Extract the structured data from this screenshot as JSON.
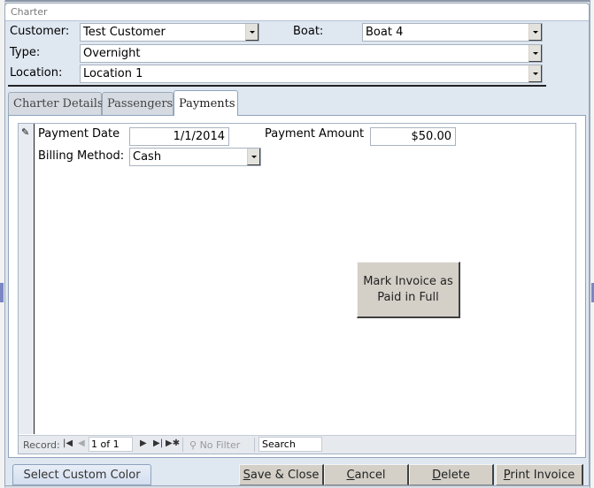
{
  "window": {
    "title": "Charter"
  },
  "header": {
    "customer": {
      "label": "Customer:",
      "value": "Test Customer"
    },
    "boat": {
      "label": "Boat:",
      "value": "Boat 4"
    },
    "type": {
      "label": "Type:",
      "value": "Overnight"
    },
    "location": {
      "label": "Location:",
      "value": "Location 1"
    }
  },
  "tabs": [
    {
      "label": "Charter Details",
      "active": false
    },
    {
      "label": "Passengers",
      "active": false
    },
    {
      "label": "Payments",
      "active": true
    }
  ],
  "payments": {
    "payment_date": {
      "label": "Payment Date",
      "value": "1/1/2014"
    },
    "payment_amount": {
      "label": "Payment Amount",
      "value": "$50.00"
    },
    "billing_method": {
      "label": "Billing Method:",
      "value": "Cash"
    },
    "mark_paid_button": {
      "line1": "Mark Invoice as",
      "line2": "Paid in Full"
    }
  },
  "record_nav": {
    "label": "Record:",
    "current": "1 of 1",
    "filter": "No Filter",
    "search_placeholder": "Search"
  },
  "footer": {
    "custom_color": "Select Custom Color",
    "save_close": {
      "accel": "S",
      "rest": "ave & Close"
    },
    "cancel": {
      "accel": "C",
      "rest": "ancel"
    },
    "delete": {
      "accel": "D",
      "rest": "elete"
    },
    "print_invoice": {
      "accel": "P",
      "rest": "rint Invoice"
    }
  }
}
